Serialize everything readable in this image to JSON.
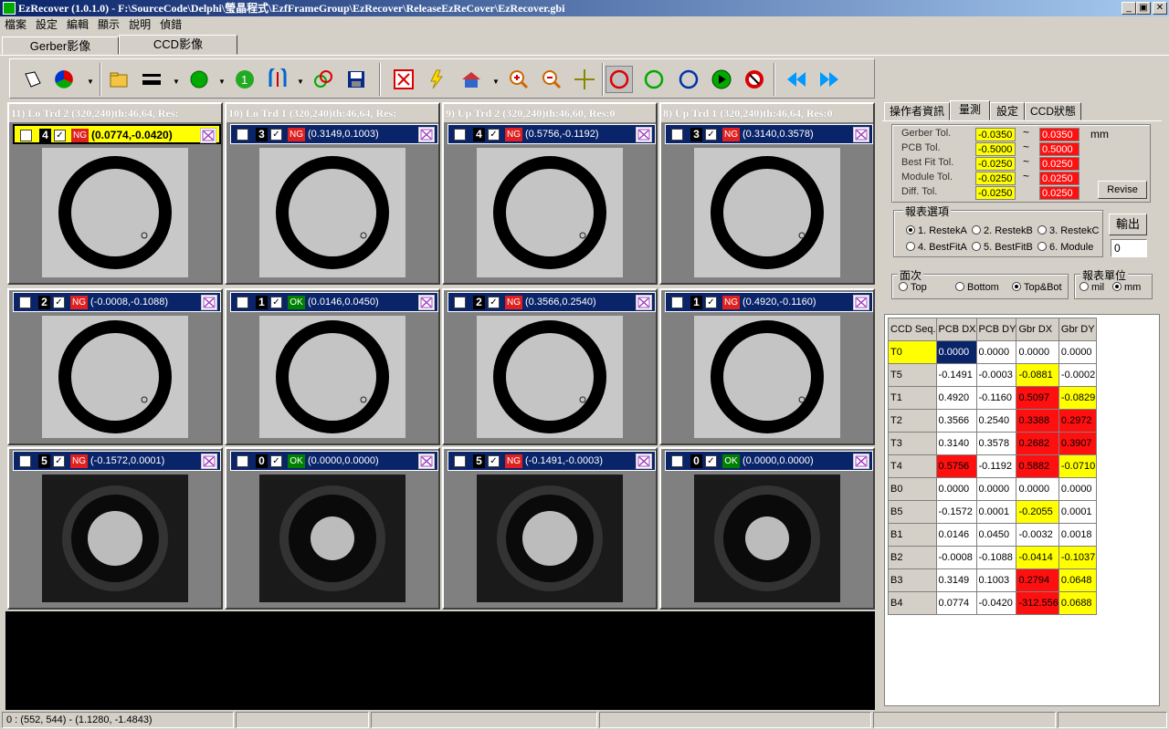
{
  "window": {
    "title": "EzRecover (1.0.1.0) - F:\\SourceCode\\Delphi\\瑩晶程式\\EzfFrameGroup\\EzRecover\\ReleaseEzReCover\\EzRecover.gbi",
    "btn_min": "_",
    "btn_max": "▣",
    "btn_close": "✕"
  },
  "menu": [
    "檔案",
    "設定",
    "編輯",
    "顯示",
    "說明",
    "偵錯"
  ],
  "tabs": [
    {
      "label": "Gerber影像"
    },
    {
      "label": "CCD影像"
    }
  ],
  "toolbar_icons": [
    "arrow-tool-icon",
    "color-wheel-icon",
    "open-folder-icon",
    "line-width-icon",
    "green-dot-icon",
    "number-one-icon",
    "compass-icon",
    "link-icon",
    "save-icon",
    "fit-screen-icon",
    "flash-icon",
    "house-icon",
    "zoom-in-icon",
    "zoom-out-icon",
    "crosshair-icon",
    "red-circle-icon",
    "green-circle-icon",
    "blue-circle-icon",
    "play-icon",
    "stop-icon",
    "rewind-icon",
    "fast-forward-icon"
  ],
  "panels": [
    {
      "header": "11) Lo Trd 2 (320,240)th:46,64, Res:",
      "num": "4",
      "status": "NG",
      "coord": "(0.0774,-0.0420)",
      "highlight": true,
      "variant": "light"
    },
    {
      "header": "10) Lo Trd 1 (320,240)th:46,64, Res:",
      "num": "3",
      "status": "NG",
      "coord": "(0.3149,0.1003)",
      "highlight": false,
      "variant": "light"
    },
    {
      "header": "9) Up Trd 2 (320,240)th:46,60, Res:0",
      "num": "4",
      "status": "NG",
      "coord": "(0.5756,-0.1192)",
      "highlight": false,
      "variant": "light"
    },
    {
      "header": "8) Up Trd 1 (320,240)th:46,64, Res:0",
      "num": "3",
      "status": "NG",
      "coord": "(0.3140,0.3578)",
      "highlight": false,
      "variant": "light"
    },
    {
      "header": "",
      "num": "2",
      "status": "NG",
      "coord": "(-0.0008,-0.1088)",
      "highlight": false,
      "variant": "light"
    },
    {
      "header": "",
      "num": "1",
      "status": "OK",
      "coord": "(0.0146,0.0450)",
      "highlight": false,
      "variant": "light"
    },
    {
      "header": "",
      "num": "2",
      "status": "NG",
      "coord": "(0.3566,0.2540)",
      "highlight": false,
      "variant": "light"
    },
    {
      "header": "",
      "num": "1",
      "status": "NG",
      "coord": "(0.4920,-0.1160)",
      "highlight": false,
      "variant": "light"
    },
    {
      "header": "",
      "num": "5",
      "status": "NG",
      "coord": "(-0.1572,0.0001)",
      "highlight": false,
      "variant": "dark"
    },
    {
      "header": "",
      "num": "0",
      "status": "OK",
      "coord": "(0.0000,0.0000)",
      "highlight": false,
      "variant": "dark"
    },
    {
      "header": "",
      "num": "5",
      "status": "NG",
      "coord": "(-0.1491,-0.0003)",
      "highlight": false,
      "variant": "dark"
    },
    {
      "header": "",
      "num": "0",
      "status": "OK",
      "coord": "(0.0000,0.0000)",
      "highlight": false,
      "variant": "dark"
    }
  ],
  "right": {
    "tabs": [
      "操作者資訊",
      "量測",
      "設定",
      "CCD狀態"
    ],
    "tolerances": [
      {
        "label": "Gerber Tol.",
        "min": "-0.0350",
        "max": "0.0350"
      },
      {
        "label": "PCB Tol.",
        "min": "-0.5000",
        "max": "0.5000"
      },
      {
        "label": "Best Fit Tol.",
        "min": "-0.0250",
        "max": "0.0250"
      },
      {
        "label": "Module Tol.",
        "min": "-0.0250",
        "max": "0.0250"
      },
      {
        "label": "Diff. Tol.",
        "min": "-0.0250",
        "max": "0.0250"
      }
    ],
    "tilde": "~",
    "unit": "mm",
    "revise": "Revise",
    "report_title": "報表選項",
    "report_opts": [
      "1. RestekA",
      "2. RestekB",
      "3. RestekC",
      "4. BestFitA",
      "5. BestFitB",
      "6. Module"
    ],
    "output_btn": "輸出",
    "output_val": "0",
    "side_title": "面次",
    "side_opts": [
      "Top",
      "Bottom",
      "Top&Bot"
    ],
    "unit_title": "報表單位",
    "unit_opts": [
      "mil",
      "mm"
    ],
    "table_headers": [
      "CCD Seq.",
      "PCB DX",
      "PCB DY",
      "Gbr DX",
      "Gbr DY"
    ],
    "table_rows": [
      [
        "T0",
        "0.0000",
        "0.0000",
        "0.0000",
        "0.0000"
      ],
      [
        "T5",
        "-0.1491",
        "-0.0003",
        "-0.0881",
        "-0.0002"
      ],
      [
        "T1",
        "0.4920",
        "-0.1160",
        "0.5097",
        "-0.0829"
      ],
      [
        "T2",
        "0.3566",
        "0.2540",
        "0.3388",
        "0.2972"
      ],
      [
        "T3",
        "0.3140",
        "0.3578",
        "0.2682",
        "0.3907"
      ],
      [
        "T4",
        "0.5756",
        "-0.1192",
        "0.5882",
        "-0.0710"
      ],
      [
        "B0",
        "0.0000",
        "0.0000",
        "0.0000",
        "0.0000"
      ],
      [
        "B5",
        "-0.1572",
        "0.0001",
        "-0.2055",
        "0.0001"
      ],
      [
        "B1",
        "0.0146",
        "0.0450",
        "-0.0032",
        "0.0018"
      ],
      [
        "B2",
        "-0.0008",
        "-0.1088",
        "-0.0414",
        "-0.1037"
      ],
      [
        "B3",
        "0.3149",
        "0.1003",
        "0.2794",
        "0.0648"
      ],
      [
        "B4",
        "0.0774",
        "-0.0420",
        "-312.556",
        "0.0688"
      ]
    ]
  },
  "status": {
    "pos": "0 : (552, 544) - (1.1280, -1.4843)"
  },
  "colors": {
    "ng": "#e02020",
    "ok": "#008000",
    "panel_bar": "#0a246a",
    "yellow": "#ffff00",
    "red": "#ff1010",
    "navy": "#0a246a"
  }
}
